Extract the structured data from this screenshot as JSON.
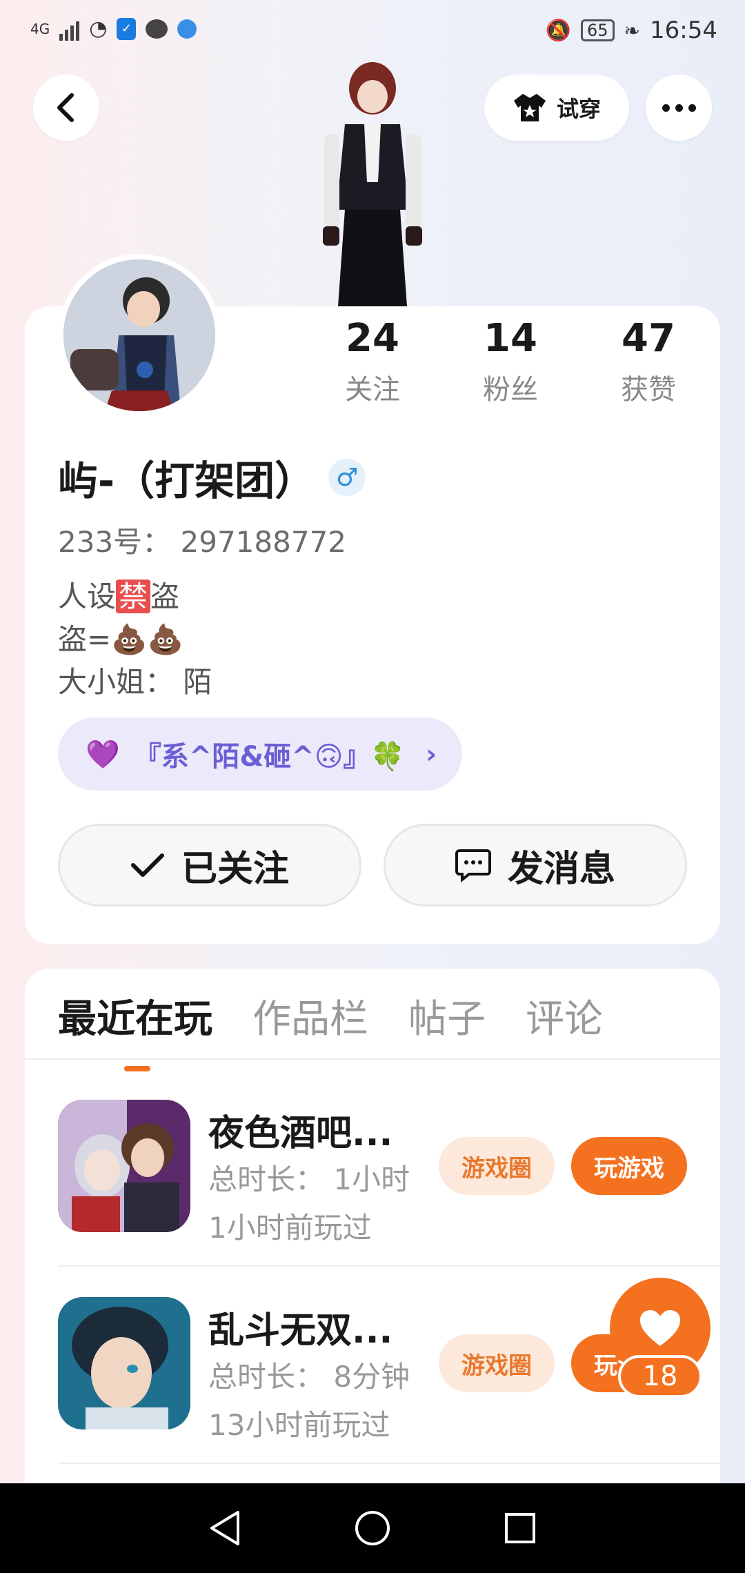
{
  "status_bar": {
    "network": "4G",
    "battery": "65",
    "time": "16:54"
  },
  "header": {
    "tryon_label": "试穿"
  },
  "profile": {
    "stats": [
      {
        "num": "24",
        "label": "关注"
      },
      {
        "num": "14",
        "label": "粉丝"
      },
      {
        "num": "47",
        "label": "获赞"
      }
    ],
    "name": "屿-（打架团）",
    "gender_symbol": "♂",
    "uid": "233号：  297188772",
    "bio_line1_a": "人设",
    "bio_line1_ban": "禁",
    "bio_line1_b": "盗",
    "bio_line2": "盗=💩💩",
    "bio_line3": "大小姐：  陌",
    "group_name": "『系^陌&砸^🙃』🍀",
    "follow_label": "已关注",
    "message_label": "发消息"
  },
  "tabs": [
    "最近在玩",
    "作品栏",
    "帖子",
    "评论"
  ],
  "games": [
    {
      "title": "夜色酒吧...",
      "duration": "总时长：  1小时",
      "last_played": "1小时前玩过",
      "circle_label": "游戏圈",
      "play_label": "玩游戏"
    },
    {
      "title": "乱斗无双...",
      "duration": "总时长：  8分钟",
      "last_played": "13小时前玩过",
      "circle_label": "游戏圈",
      "play_label": "玩游戏"
    }
  ],
  "like_count": "18",
  "colors": {
    "accent": "#f4711f",
    "group_bg": "#ece9fb",
    "group_text": "#6b5fd4"
  }
}
